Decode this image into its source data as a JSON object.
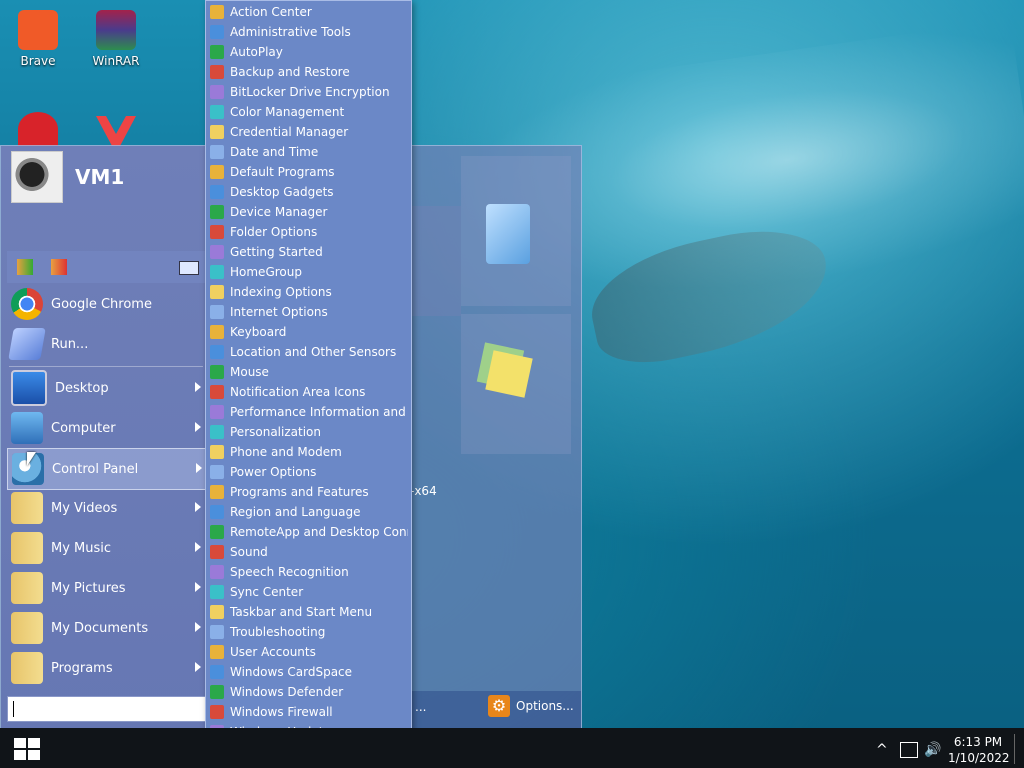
{
  "desktop": {
    "icons": [
      {
        "label": "Brave",
        "color": "#f05a28"
      },
      {
        "label": "WinRAR",
        "color": "#a3224b"
      }
    ]
  },
  "start_menu": {
    "user_name": "VM1",
    "items": [
      {
        "label": "Google Chrome",
        "icon": "chrome-icon",
        "arrow": false
      },
      {
        "label": "Run...",
        "icon": "run-icon",
        "arrow": false
      },
      {
        "label": "Desktop",
        "icon": "desktop-icon",
        "arrow": true
      },
      {
        "label": "Computer",
        "icon": "computer-icon",
        "arrow": true
      },
      {
        "label": "Control Panel",
        "icon": "control-panel-icon",
        "arrow": true
      },
      {
        "label": "My Videos",
        "icon": "folder-icon",
        "arrow": true
      },
      {
        "label": "My Music",
        "icon": "folder-icon",
        "arrow": true
      },
      {
        "label": "My Pictures",
        "icon": "folder-icon",
        "arrow": true
      },
      {
        "label": "My Documents",
        "icon": "folder-icon",
        "arrow": true
      },
      {
        "label": "Programs",
        "icon": "folder-icon",
        "arrow": true
      }
    ],
    "right_text_x64": "-x64",
    "dots_label": "...",
    "options_label": "Options..."
  },
  "control_panel": {
    "items": [
      "Action Center",
      "Administrative Tools",
      "AutoPlay",
      "Backup and Restore",
      "BitLocker Drive Encryption",
      "Color Management",
      "Credential Manager",
      "Date and Time",
      "Default Programs",
      "Desktop Gadgets",
      "Device Manager",
      "Folder Options",
      "Getting Started",
      "HomeGroup",
      "Indexing Options",
      "Internet Options",
      "Keyboard",
      "Location and Other Sensors",
      "Mouse",
      "Notification Area Icons",
      "Performance Information and T",
      "Personalization",
      "Phone and Modem",
      "Power Options",
      "Programs and Features",
      "Region and Language",
      "RemoteApp and Desktop Conn",
      "Sound",
      "Speech Recognition",
      "Sync Center",
      "Taskbar and Start Menu",
      "Troubleshooting",
      "User Accounts",
      "Windows CardSpace",
      "Windows Defender",
      "Windows Firewall",
      "Windows Update"
    ]
  },
  "taskbar": {
    "time": "6:13 PM",
    "date": "1/10/2022"
  },
  "colors": {
    "cp_bg": "#6b88c7",
    "taskbar": "#101418",
    "options_gear": "#e8861a"
  }
}
